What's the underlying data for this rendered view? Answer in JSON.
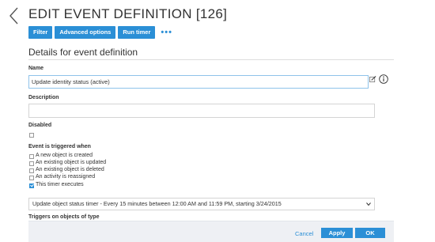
{
  "header": {
    "title": "EDIT EVENT DEFINITION [126]",
    "back_icon": "chevron-left-icon"
  },
  "toolbar": {
    "buttons": [
      "Filter",
      "Advanced options",
      "Run timer"
    ],
    "more_label": "•••"
  },
  "section": {
    "title": "Details for event definition"
  },
  "form": {
    "name_label": "Name",
    "name_value": "Update identity status (active)",
    "description_label": "Description",
    "description_value": "",
    "disabled_label": "Disabled",
    "disabled_checked": false,
    "trigger_label": "Event is triggered when",
    "trigger_options": [
      {
        "label": "A new object is created",
        "checked": false
      },
      {
        "label": "An existing object is updated",
        "checked": false
      },
      {
        "label": "An existing object is deleted",
        "checked": false
      },
      {
        "label": "An activity is reassigned",
        "checked": false
      },
      {
        "label": "This timer executes",
        "checked": true
      }
    ],
    "timer_select_value": "Update object status timer - Every 15 minutes between 12:00 AM and 11:59 PM, starting 3/24/2015",
    "partial_label": "Triggers on objects of type"
  },
  "footer": {
    "cancel_label": "Cancel",
    "apply_label": "Apply",
    "ok_label": "OK"
  },
  "colors": {
    "accent": "#2b8fd6",
    "footer_bg": "#eef0f4"
  }
}
